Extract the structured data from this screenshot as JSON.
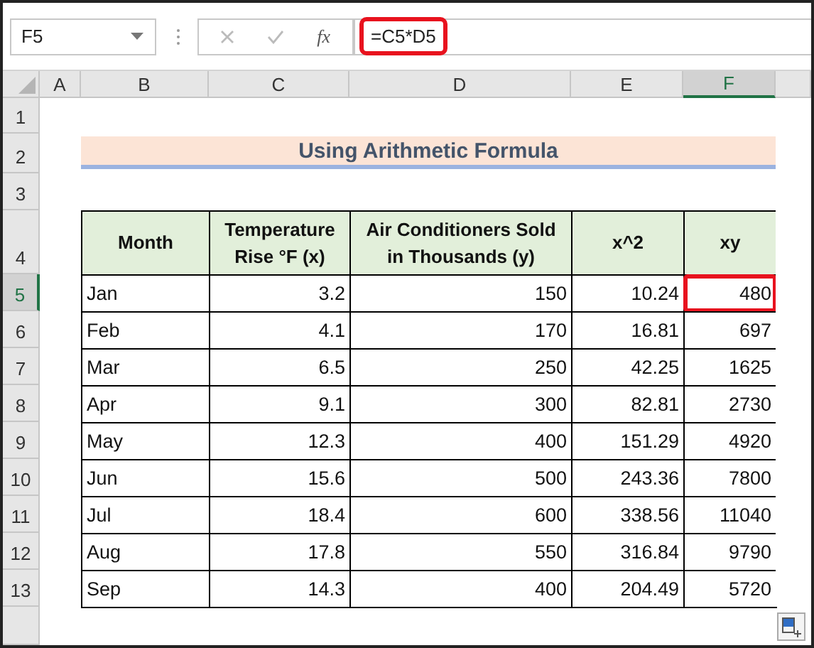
{
  "name_box": {
    "value": "F5"
  },
  "formula_bar": {
    "label": "fx",
    "formula": "=C5*D5",
    "highlighted": true
  },
  "column_headers": [
    {
      "label": "A",
      "selected": false
    },
    {
      "label": "B",
      "selected": false
    },
    {
      "label": "C",
      "selected": false
    },
    {
      "label": "D",
      "selected": false
    },
    {
      "label": "E",
      "selected": false
    },
    {
      "label": "F",
      "selected": true
    }
  ],
  "row_headers": [
    {
      "label": "1",
      "selected": false
    },
    {
      "label": "2",
      "selected": false
    },
    {
      "label": "3",
      "selected": false
    },
    {
      "label": "4",
      "selected": false
    },
    {
      "label": "5",
      "selected": true
    },
    {
      "label": "6",
      "selected": false
    },
    {
      "label": "7",
      "selected": false
    },
    {
      "label": "8",
      "selected": false
    },
    {
      "label": "9",
      "selected": false
    },
    {
      "label": "10",
      "selected": false
    },
    {
      "label": "11",
      "selected": false
    },
    {
      "label": "12",
      "selected": false
    },
    {
      "label": "13",
      "selected": false
    }
  ],
  "title": "Using Arithmetic Formula",
  "table": {
    "columns": [
      {
        "label": "Month",
        "kind": "text"
      },
      {
        "label": "Temperature Rise °F (x)",
        "kind": "number"
      },
      {
        "label": "Air Conditioners Sold in Thousands (y)",
        "kind": "number"
      },
      {
        "label": "x^2",
        "kind": "number"
      },
      {
        "label": "xy",
        "kind": "number"
      }
    ],
    "rows": [
      {
        "cells": [
          {
            "text": "Jan",
            "highlighted": false
          },
          {
            "text": "3.2",
            "highlighted": false
          },
          {
            "text": "150",
            "highlighted": false
          },
          {
            "text": "10.24",
            "highlighted": false
          },
          {
            "text": "480",
            "highlighted": true
          }
        ]
      },
      {
        "cells": [
          {
            "text": "Feb",
            "highlighted": false
          },
          {
            "text": "4.1",
            "highlighted": false
          },
          {
            "text": "170",
            "highlighted": false
          },
          {
            "text": "16.81",
            "highlighted": false
          },
          {
            "text": "697",
            "highlighted": false
          }
        ]
      },
      {
        "cells": [
          {
            "text": "Mar",
            "highlighted": false
          },
          {
            "text": "6.5",
            "highlighted": false
          },
          {
            "text": "250",
            "highlighted": false
          },
          {
            "text": "42.25",
            "highlighted": false
          },
          {
            "text": "1625",
            "highlighted": false
          }
        ]
      },
      {
        "cells": [
          {
            "text": "Apr",
            "highlighted": false
          },
          {
            "text": "9.1",
            "highlighted": false
          },
          {
            "text": "300",
            "highlighted": false
          },
          {
            "text": "82.81",
            "highlighted": false
          },
          {
            "text": "2730",
            "highlighted": false
          }
        ]
      },
      {
        "cells": [
          {
            "text": "May",
            "highlighted": false
          },
          {
            "text": "12.3",
            "highlighted": false
          },
          {
            "text": "400",
            "highlighted": false
          },
          {
            "text": "151.29",
            "highlighted": false
          },
          {
            "text": "4920",
            "highlighted": false
          }
        ]
      },
      {
        "cells": [
          {
            "text": "Jun",
            "highlighted": false
          },
          {
            "text": "15.6",
            "highlighted": false
          },
          {
            "text": "500",
            "highlighted": false
          },
          {
            "text": "243.36",
            "highlighted": false
          },
          {
            "text": "7800",
            "highlighted": false
          }
        ]
      },
      {
        "cells": [
          {
            "text": "Jul",
            "highlighted": false
          },
          {
            "text": "18.4",
            "highlighted": false
          },
          {
            "text": "600",
            "highlighted": false
          },
          {
            "text": "338.56",
            "highlighted": false
          },
          {
            "text": "11040",
            "highlighted": false
          }
        ]
      },
      {
        "cells": [
          {
            "text": "Aug",
            "highlighted": false
          },
          {
            "text": "17.8",
            "highlighted": false
          },
          {
            "text": "550",
            "highlighted": false
          },
          {
            "text": "316.84",
            "highlighted": false
          },
          {
            "text": "9790",
            "highlighted": false
          }
        ]
      },
      {
        "cells": [
          {
            "text": "Sep",
            "highlighted": false
          },
          {
            "text": "14.3",
            "highlighted": false
          },
          {
            "text": "400",
            "highlighted": false
          },
          {
            "text": "204.49",
            "highlighted": false
          },
          {
            "text": "5720",
            "highlighted": false
          }
        ]
      }
    ]
  }
}
